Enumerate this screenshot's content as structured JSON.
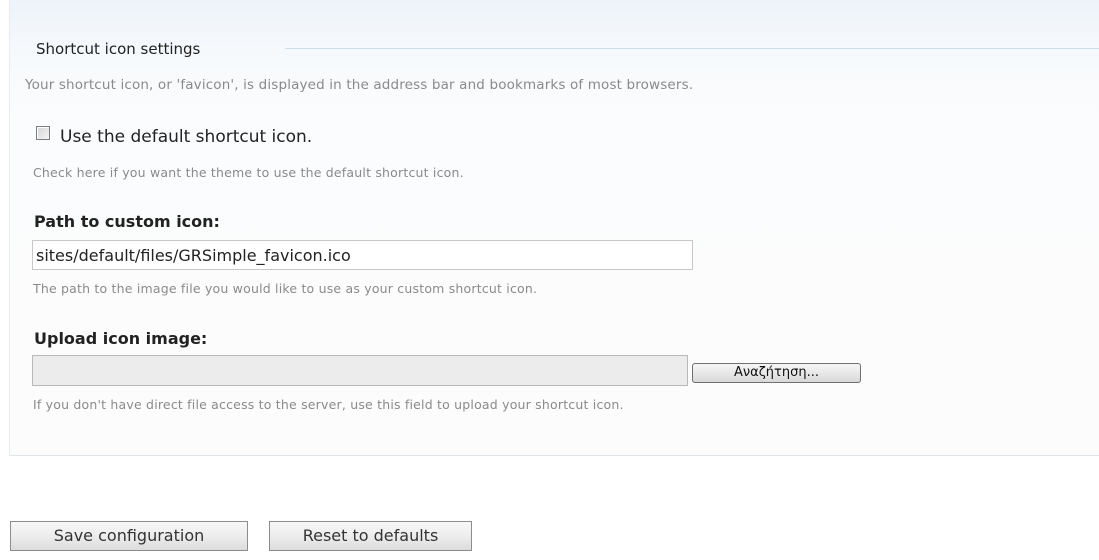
{
  "fieldset": {
    "legend": "Shortcut icon settings",
    "description": "Your shortcut icon, or 'favicon', is displayed in the address bar and bookmarks of most browsers."
  },
  "default_icon": {
    "label": "Use the default shortcut icon.",
    "checked": false,
    "description": "Check here if you want the theme to use the default shortcut icon."
  },
  "custom_path": {
    "label": "Path to custom icon:",
    "value": "sites/default/files/GRSimple_favicon.ico",
    "description": "The path to the image file you would like to use as your custom shortcut icon."
  },
  "upload": {
    "label": "Upload icon image:",
    "value": "",
    "browse_label": "Αναζήτηση...",
    "description": "If you don't have direct file access to the server, use this field to upload your shortcut icon."
  },
  "actions": {
    "save_label": "Save configuration",
    "reset_label": "Reset to defaults"
  }
}
